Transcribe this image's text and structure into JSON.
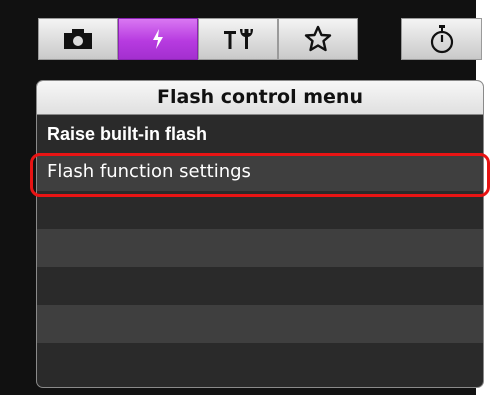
{
  "tabs": [
    {
      "id": "shooting",
      "icon": "camera-icon",
      "selected": false
    },
    {
      "id": "flash",
      "icon": "flash-bolt-icon",
      "selected": true
    },
    {
      "id": "setup",
      "icon": "setup-tools-icon",
      "selected": false
    },
    {
      "id": "mymenu",
      "icon": "star-outline-icon",
      "selected": false
    },
    {
      "id": "timer",
      "icon": "stopwatch-icon",
      "selected": false
    }
  ],
  "colors": {
    "selected_tab": "#b73be0",
    "highlight_border": "#e81414",
    "row_dark": "#2a2a2a",
    "row_light": "#3f3f3f"
  },
  "panel": {
    "title": "Flash control menu",
    "items": [
      {
        "label": "Raise built-in flash"
      },
      {
        "label": "Flash function settings",
        "highlighted": true
      },
      {
        "label": ""
      },
      {
        "label": ""
      },
      {
        "label": ""
      },
      {
        "label": ""
      },
      {
        "label": ""
      }
    ]
  }
}
